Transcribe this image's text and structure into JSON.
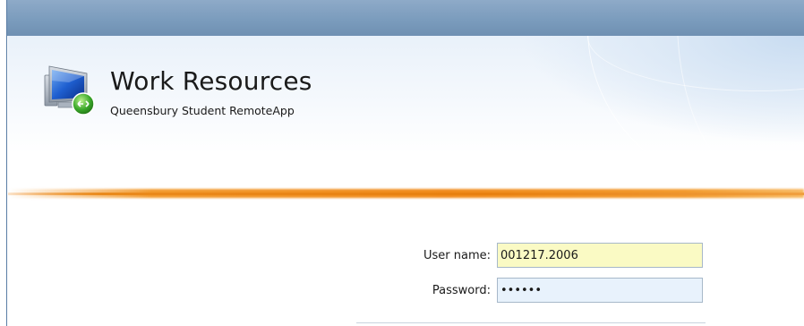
{
  "header": {
    "title": "Work Resources",
    "subtitle": "Queensbury Student RemoteApp",
    "logo_icon": "remoteapp-computer-icon"
  },
  "login": {
    "username_label": "User name:",
    "username_value": "001217.2006",
    "password_label": "Password:",
    "password_value": "••••••"
  },
  "colors": {
    "top_bar": "#7b9cbd",
    "accent_line": "#f08a1a",
    "username_bg": "#fafac4",
    "password_bg": "#e8f2fc"
  }
}
